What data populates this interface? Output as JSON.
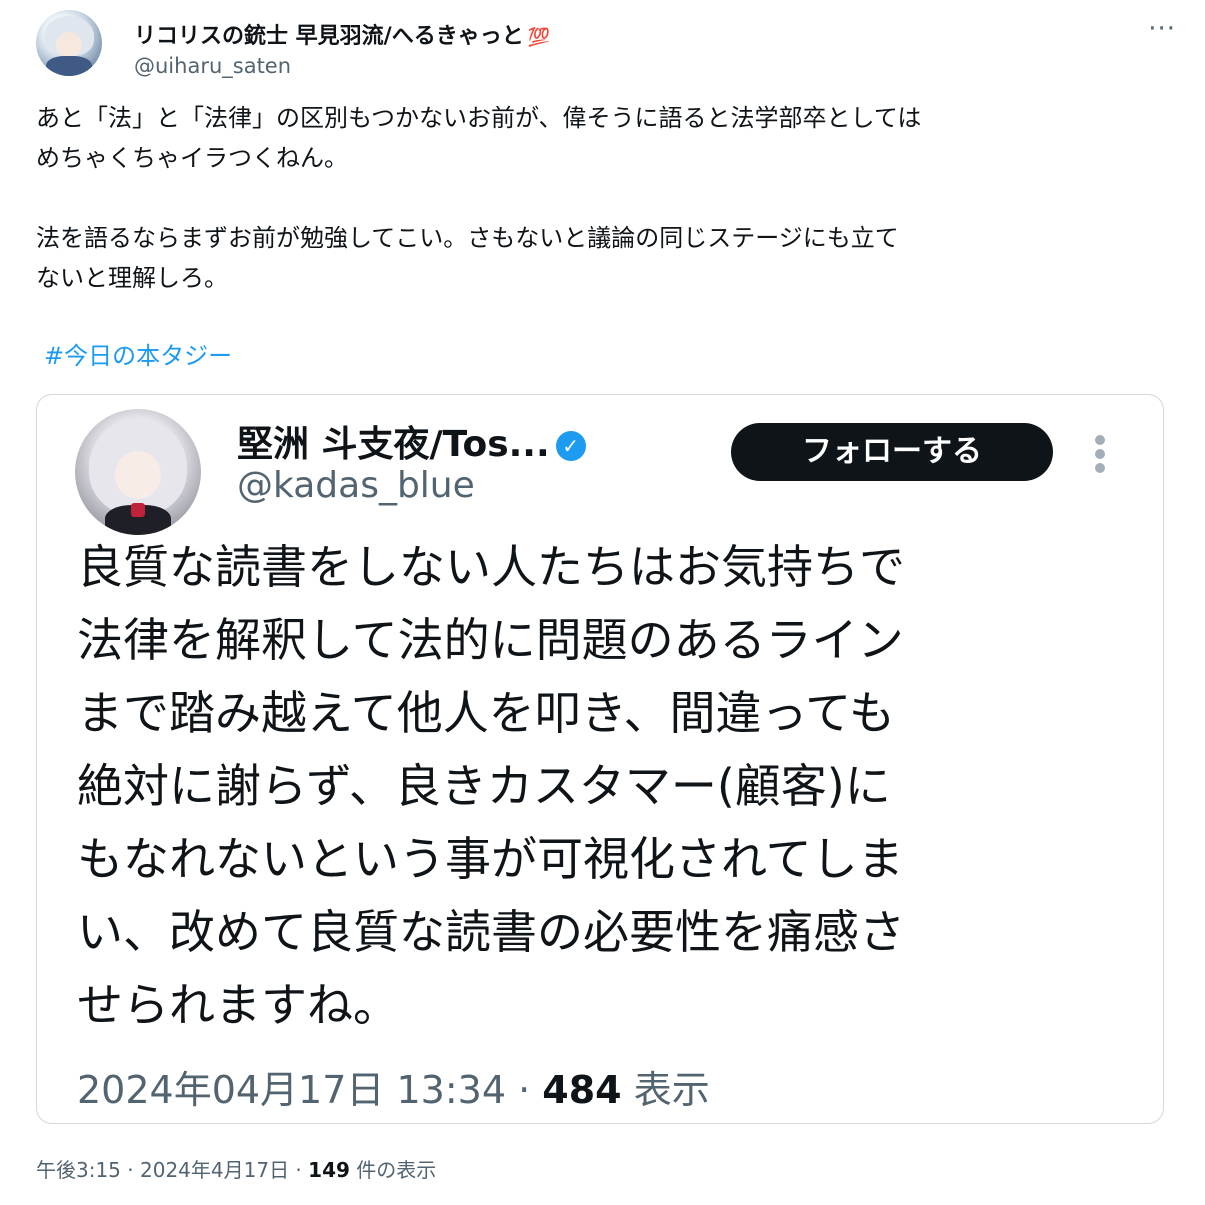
{
  "tweet": {
    "author_name": "リコリスの銃士 早見羽流/へるきゃっと",
    "author_emoji": "💯",
    "author_handle": "@uiharu_saten",
    "more_label": "···",
    "paragraph_1": "あと「法」と「法律」の区別もつかないお前が、偉そうに語ると法学部卒としては\nめちゃくちゃイラつくねん。",
    "paragraph_2": "法を語るならまずお前が勉強してこい。さもないと議論の同じステージにも立て\nないと理解しろ。",
    "hashtag": "#今日の本タジー",
    "time": "午後3:15",
    "date": "2024年4月17日",
    "views_count": "149",
    "views_label": "件の表示"
  },
  "quoted": {
    "author_name": "堅洲 斗支夜/Tos...",
    "verified_icon": "check-badge-icon",
    "author_handle": "@kadas_blue",
    "follow_label": "フォローする",
    "text": "良質な読書をしない人たちはお気持ちで\n法律を解釈して法的に問題のあるライン\nまで踏み越えて他人を叩き、間違っても\n絶対に謝らず、良きカスタマー(顧客)に\nもなれないという事が可視化されてしま\nい、改めて良質な読書の必要性を痛感さ\nせられますね。",
    "timestamp": "2024年04月17日 13:34",
    "views_count": "484",
    "views_label": "表示"
  },
  "colors": {
    "link": "#1d9bf0",
    "secondary_text": "#536471",
    "border": "#cfd9de",
    "follow_bg": "#0f1419"
  }
}
